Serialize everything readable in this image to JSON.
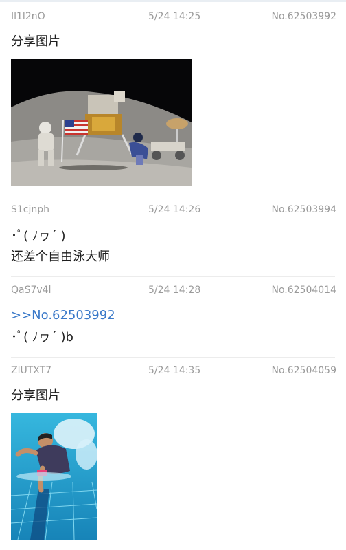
{
  "posts": [
    {
      "uid": "Il1l2nO",
      "time": "5/24 14:25",
      "no": "No.62503992",
      "lines": [
        "分享图片"
      ],
      "image": "moon-landing-photo"
    },
    {
      "uid": "S1cjnph",
      "time": "5/24 14:26",
      "no": "No.62503994",
      "lines": [
        "･ﾟ( ﾉヮ´ )",
        "还差个自由泳大师"
      ]
    },
    {
      "uid": "QaS7v4l",
      "time": "5/24 14:28",
      "no": "No.62504014",
      "quote": ">>No.62503992",
      "lines": [
        "･ﾟ( ﾉヮ´ )b"
      ]
    },
    {
      "uid": "ZlUTXT7",
      "time": "5/24 14:35",
      "no": "No.62504059",
      "lines": [
        "分享图片"
      ],
      "image": "swimmer-photo"
    }
  ],
  "colors": {
    "meta": "#9a9a9a",
    "quote": "#3a79c9",
    "text": "#1e1e1e"
  }
}
